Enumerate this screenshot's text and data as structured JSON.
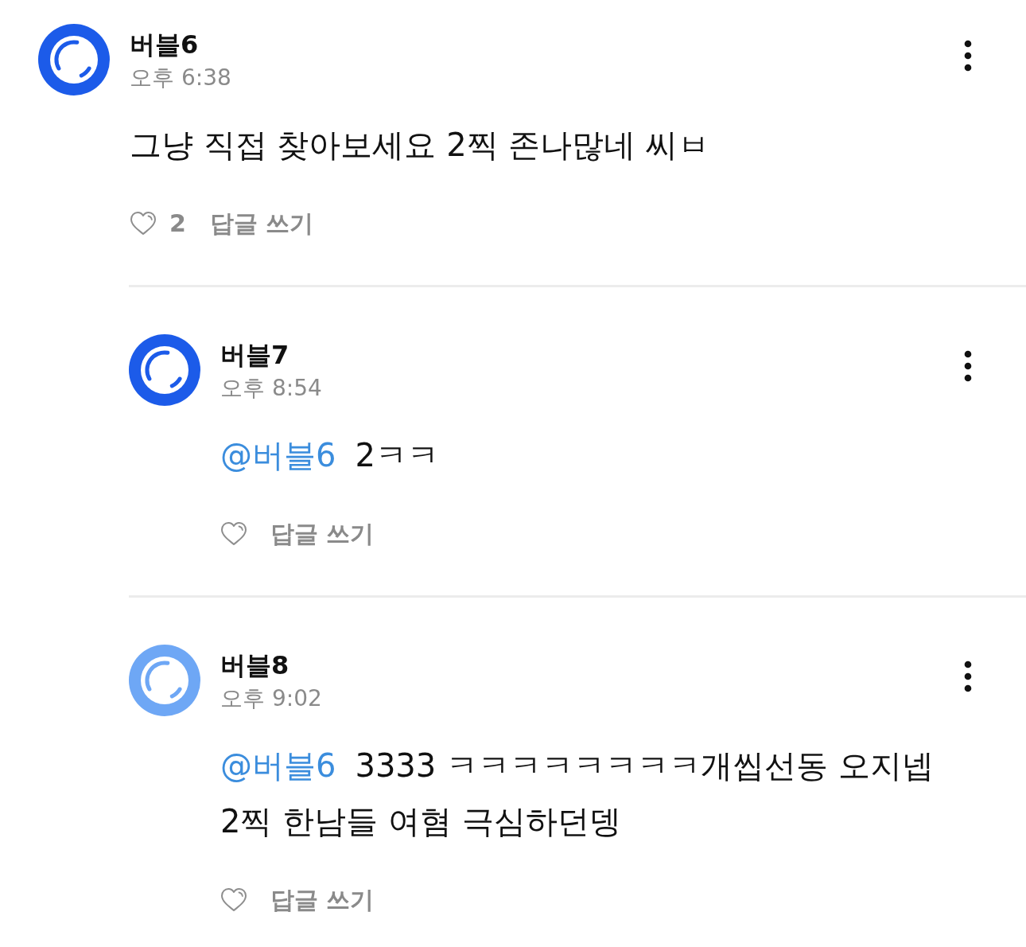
{
  "comments": [
    {
      "author": "버블6",
      "time": "오후 6:38",
      "color": "#1c5be9",
      "text": "그냥 직접 찾아보세요 2찍 존나많네 씨ㅂ",
      "liked": false,
      "likes": "2",
      "reply_label": "답글 쓰기",
      "replies": [
        {
          "author": "버블7",
          "time": "오후 8:54",
          "color": "#1c5be9",
          "mention": "@버블6",
          "text": "2ㅋㅋ",
          "liked": false,
          "reply_label": "답글 쓰기"
        },
        {
          "author": "버블8",
          "time": "오후 9:02",
          "color": "#6ea7f5",
          "mention": "@버블6",
          "text": "3333 ㅋㅋㅋㅋㅋㅋㅋㅋ개씹선동 오지넵 2찍 한남들 여혐 극심하던뎅",
          "liked": false,
          "reply_label": "답글 쓰기"
        }
      ]
    }
  ]
}
